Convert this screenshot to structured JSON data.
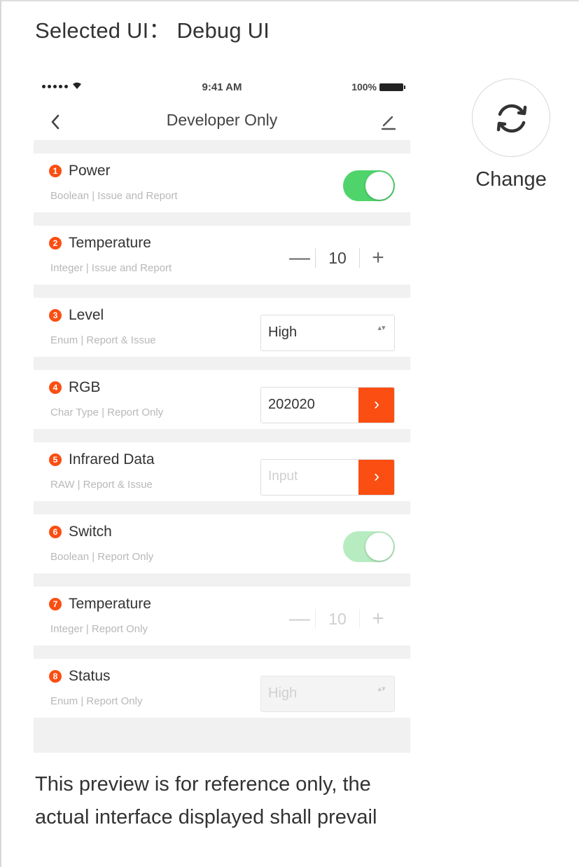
{
  "header": {
    "selected_ui": "Selected UI： Debug UI"
  },
  "status_bar": {
    "time": "9:41 AM",
    "battery": "100%"
  },
  "nav": {
    "title": "Developer Only"
  },
  "rows": [
    {
      "num": "1",
      "name": "Power",
      "desc": "Boolean | Issue and Report",
      "control": "toggle",
      "on": true,
      "enabled": true
    },
    {
      "num": "2",
      "name": "Temperature",
      "desc": "Integer | Issue and Report",
      "control": "stepper",
      "value": "10",
      "enabled": true
    },
    {
      "num": "3",
      "name": "Level",
      "desc": "Enum | Report & Issue",
      "control": "select",
      "value": "High",
      "enabled": true
    },
    {
      "num": "4",
      "name": "RGB",
      "desc": "Char Type | Report Only",
      "control": "field",
      "value": "202020",
      "enabled": true
    },
    {
      "num": "5",
      "name": "Infrared Data",
      "desc": "RAW | Report & Issue",
      "control": "field",
      "placeholder": "Input",
      "enabled": true
    },
    {
      "num": "6",
      "name": "Switch",
      "desc": "Boolean | Report Only",
      "control": "toggle",
      "on": true,
      "enabled": false
    },
    {
      "num": "7",
      "name": "Temperature",
      "desc": "Integer | Report Only",
      "control": "stepper",
      "value": "10",
      "enabled": false
    },
    {
      "num": "8",
      "name": "Status",
      "desc": "Enum | Report Only",
      "control": "select",
      "value": "High",
      "enabled": false
    }
  ],
  "stepper_symbols": {
    "minus": "—",
    "plus": "+"
  },
  "symbols": {
    "go": "›",
    "select_arrows": "▴▾"
  },
  "change": {
    "label": "Change",
    "icon": "refresh-icon"
  },
  "note": {
    "text": "This preview is for reference only, the actual interface displayed shall prevail"
  },
  "colors": {
    "accent": "#fb4e12",
    "toggle_on": "#4fd46b",
    "toggle_faded": "#b7ecc1",
    "section_gap": "#f1f1f1"
  }
}
